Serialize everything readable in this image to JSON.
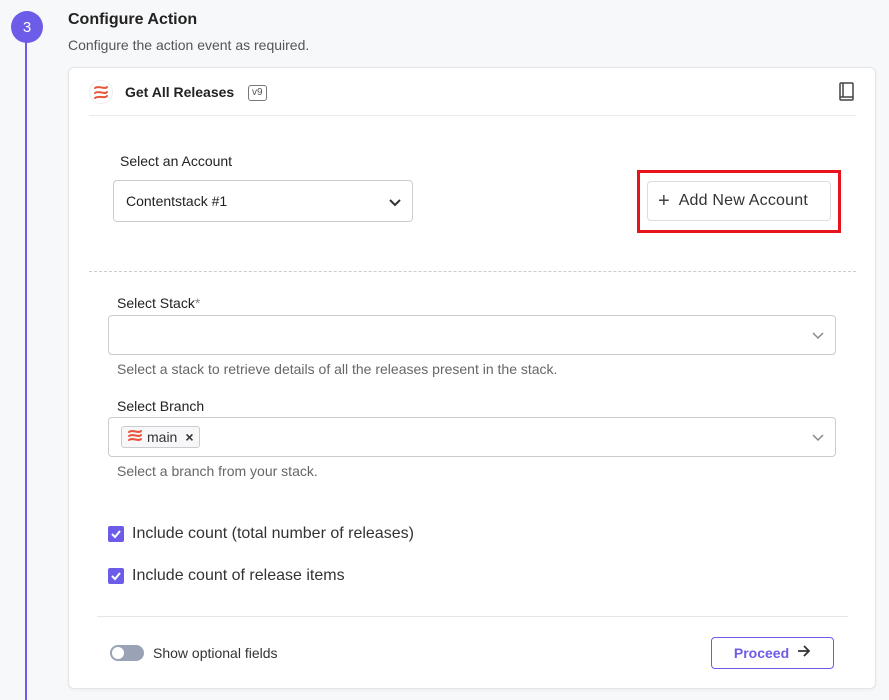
{
  "step": {
    "number": "3",
    "title": "Configure Action",
    "subtitle": "Configure the action event as required."
  },
  "action": {
    "title": "Get All Releases",
    "version": "v9",
    "app_icon": "contentstack-logo",
    "docs_icon": "book-icon"
  },
  "account": {
    "label": "Select an Account",
    "selected": "Contentstack #1",
    "add_button_label": "Add New Account",
    "highlight_color": "#e8141b"
  },
  "stack": {
    "label": "Select Stack",
    "required_mark": "*",
    "value": "",
    "help": "Select a stack to retrieve details of all the releases present in the stack."
  },
  "branch": {
    "label": "Select Branch",
    "chips": [
      "main"
    ],
    "help": "Select a branch from your stack."
  },
  "options": [
    {
      "label": "Include count (total number of releases)",
      "checked": true
    },
    {
      "label": "Include count of release items",
      "checked": true
    }
  ],
  "footer": {
    "toggle_label": "Show optional fields",
    "toggle_on": false,
    "proceed_label": "Proceed"
  },
  "colors": {
    "accent": "#6c5ce7",
    "logo": "#e8553b"
  }
}
